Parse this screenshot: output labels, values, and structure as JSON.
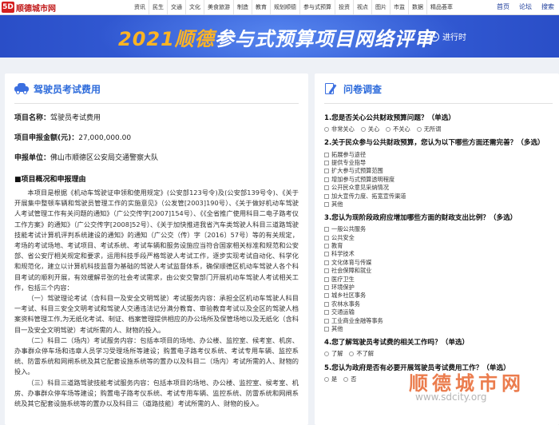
{
  "site": {
    "logo_mark": "5D",
    "logo_text": "顺德城市网",
    "nav": [
      "资讯",
      "民生",
      "交通",
      "文化",
      "美食旅游",
      "制造",
      "教育",
      "规划顺德",
      "参与式预算",
      "投资",
      "视点",
      "图片",
      "市监",
      "数据",
      "精品荟萃"
    ],
    "user_links": [
      "首页",
      "论坛",
      "搜索"
    ]
  },
  "banner": {
    "title_year": "2021顺德",
    "title_rest": "参与式预算项目网络评审",
    "status": "进行时",
    "colors": {
      "background": "#3a66e0",
      "year": "#ffb423"
    }
  },
  "project": {
    "section_title": "驾驶员考试费用",
    "name_label": "项目名称：",
    "name_value": "驾驶员考试费用",
    "budget_label": "项目申报金额(元)：",
    "budget_value": "27,000,000.00",
    "unit_label": "申报单位：",
    "unit_value": "佛山市顺德区公安局交通警察大队",
    "overview_title": "■项目概况和申报理由",
    "paragraphs": [
      "本项目是根据《机动车驾驶证申领和使用规定》(公安部123号令)及(公安部139号令)、《关于开展集中整顿车辆和驾驶员管理工作的实施意见》（公发管[2003]190号）、《关于做好机动车驾驶人考试管理工作有关问题的通知》（广公交传字[2007]154号）、《《全省推广使用科目二电子路考仪工作方案》的通知》（广公交传字[2008]52号）、《关于加快推进我省汽车类驾驶人科目三道路驾驶技能考试计算机评判系统建设的通知》的通知（广公交（传）字〔2016〕57号）等的有关规定，考场的考试场地、考试项目、考试系统、考试车辆和服务设施应当符合国家相关标准和规范和公安部、省公安厅相关规定和要求，运用科技手段严格驾驶人考试工作，逐步实现考试自动化、科学化和规范化，建立以计算机科技监督为基础的驾驶人考试监督体系，确保顺德区机动车驾驶人各个科目考试的顺利开展，有效缓解류张的社会考试需求，由公安交警部门开展机动车驾驶人考试相关工作，包括三个内容：",
      "（一）驾驶理论考试（含科目一及安全文明驾驶）考试服务内容：承担全区机动车驾驶人科目一考试、科目三安全文明考试和驾驶人交通违法记分满分教育、审验教育考试以及全区的驾驶人档案资料管理工作,为无纸化考试、制证、档案管理提供相应的办公场所及保管场地以及无纸化（含科目一及安全文明驾驶）考试所需的人、财物的投入。",
      "（二）科目二（场内）考试服务内容：包括本项目的场地、办公楼、监控室、候考室、机房、办事群众停车场和违章人员学习受理场所等建设；购置电子路考仪系统、考试专用车辆、监控系统、防雷系统和网闸系统及其它配套设施系统等的置办以及科目二（场内）考试所需的人、财物的投入。",
      "（三）科目三道路驾驶技能考试服务内容：包括本项目的场地、办公楼、监控室、候考室、机房、办事群众停车场等建设；购置电子路考仪系统、考试专用车辆、监控系统、防雷系统和网闸系统及其它配套设施系统等的置办以及科目三（道路技能）考试所需的人、财物的投入。"
    ]
  },
  "survey": {
    "section_title": "问卷调查",
    "questions": [
      {
        "title": "1.您是否关心公共财政预算问题？（单选）",
        "type": "radio",
        "layout": "row",
        "options": [
          "非常关心",
          "关心",
          "不关心",
          "无所谓"
        ]
      },
      {
        "title": "2.关于民众参与公共财政预算，您认为以下哪些方面还需完善？（多选）",
        "type": "check",
        "layout": "col",
        "options": [
          "拓展参与途径",
          "提供专业指导",
          "扩大参与式预算范围",
          "增加参与式预算透明程度",
          "公开民众意见采纳情况",
          "加大宣传力度、拓宽宣传渠道",
          "其他"
        ]
      },
      {
        "title": "3.您认为现阶段政府应增加哪些方面的财政支出比例？（多选）",
        "type": "check",
        "layout": "col",
        "options": [
          "一般公共服务",
          "公共安全",
          "教育",
          "科学技术",
          "文化体育与传媒",
          "社会保障和就业",
          "医疗卫生",
          "环境保护",
          "城乡社区事务",
          "农林水事务",
          "交通运输",
          "工业商业金融等事务",
          "其他"
        ]
      },
      {
        "title": "4.您了解驾驶员考试费的相关工作吗？（单选）",
        "type": "radio",
        "layout": "row",
        "options": [
          "了解",
          "不了解"
        ]
      },
      {
        "title": "5.您认为政府是否有必要开展驾驶员考试费用工作？（单选）",
        "type": "radio",
        "layout": "row",
        "options": [
          "是",
          "否"
        ]
      }
    ]
  },
  "watermark": {
    "text": "顺德城市网",
    "url": "www.sdcity.org"
  }
}
